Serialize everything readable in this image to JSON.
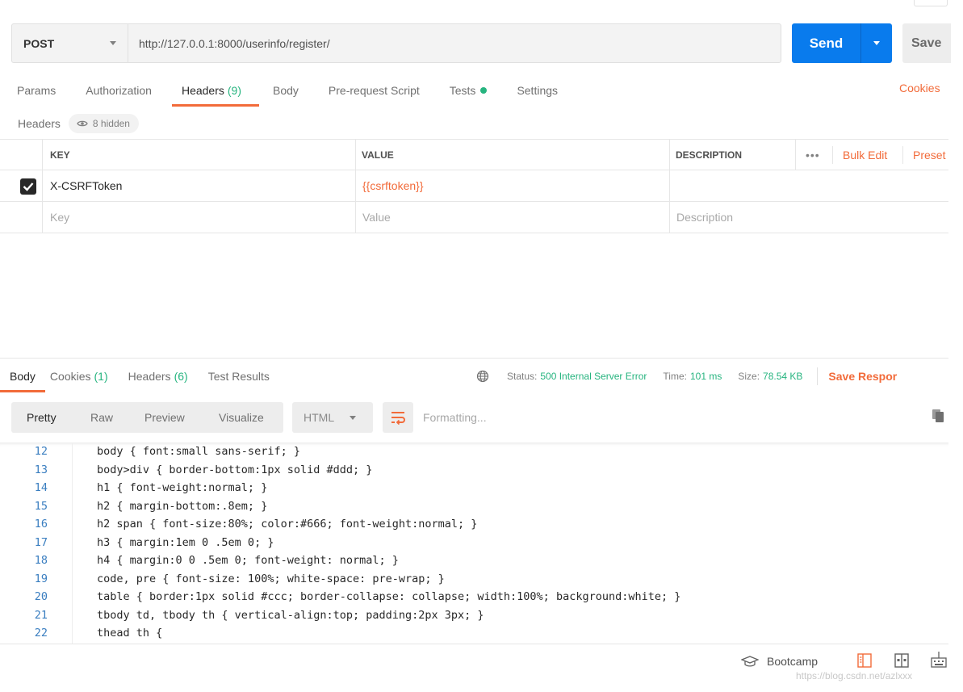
{
  "request": {
    "method": "POST",
    "url": "http://127.0.0.1:8000/userinfo/register/",
    "send_label": "Send",
    "save_label": "Save"
  },
  "request_tabs": {
    "params": "Params",
    "authorization": "Authorization",
    "headers": "Headers",
    "headers_count": "(9)",
    "body": "Body",
    "prerequest": "Pre-request Script",
    "tests": "Tests",
    "settings": "Settings",
    "cookies": "Cookies"
  },
  "headers_panel": {
    "label": "Headers",
    "hidden_label": "8 hidden",
    "columns": {
      "key": "KEY",
      "value": "VALUE",
      "description": "DESCRIPTION"
    },
    "more_label": "•••",
    "bulk_edit": "Bulk Edit",
    "presets": "Preset",
    "rows": [
      {
        "key": "X-CSRFToken",
        "value": "{{csrftoken}}",
        "description": "",
        "checked": true
      }
    ],
    "placeholders": {
      "key": "Key",
      "value": "Value",
      "description": "Description"
    }
  },
  "response": {
    "tabs": {
      "body": "Body",
      "cookies": "Cookies",
      "cookies_count": "(1)",
      "headers": "Headers",
      "headers_count": "(6)",
      "test_results": "Test Results"
    },
    "status_label": "Status:",
    "status_value": "500 Internal Server Error",
    "time_label": "Time:",
    "time_value": "101 ms",
    "size_label": "Size:",
    "size_value": "78.54 KB",
    "save_response": "Save Respor",
    "views": {
      "pretty": "Pretty",
      "raw": "Raw",
      "preview": "Preview",
      "visualize": "Visualize"
    },
    "format": "HTML",
    "formatting_placeholder": "Formatting...",
    "code_lines": [
      {
        "n": "12",
        "text": "body { font:small sans-serif; }"
      },
      {
        "n": "13",
        "text": "body>div { border-bottom:1px solid #ddd; }"
      },
      {
        "n": "14",
        "text": "h1 { font-weight:normal; }"
      },
      {
        "n": "15",
        "text": "h2 { margin-bottom:.8em; }"
      },
      {
        "n": "16",
        "text": "h2 span { font-size:80%; color:#666; font-weight:normal; }"
      },
      {
        "n": "17",
        "text": "h3 { margin:1em 0 .5em 0; }"
      },
      {
        "n": "18",
        "text": "h4 { margin:0 0 .5em 0; font-weight: normal; }"
      },
      {
        "n": "19",
        "text": "code, pre { font-size: 100%; white-space: pre-wrap; }"
      },
      {
        "n": "20",
        "text": "table { border:1px solid #ccc; border-collapse: collapse; width:100%; background:white; }"
      },
      {
        "n": "21",
        "text": "tbody td, tbody th { vertical-align:top; padding:2px 3px; }"
      },
      {
        "n": "22",
        "text": "thead th {"
      }
    ]
  },
  "footer": {
    "bootcamp": "Bootcamp",
    "watermark": "https://blog.csdn.net/azlxxx"
  },
  "colors": {
    "accent": "#f26b3a",
    "send_blue": "#097bed",
    "status_green": "#26b47f"
  },
  "icons": [
    "chevron-down-icon",
    "eye-icon",
    "check-icon",
    "globe-icon",
    "wrap-lines-icon",
    "copy-icon",
    "graduation-cap-icon",
    "sidebar-toggle-icon",
    "two-pane-icon",
    "keyboard-shortcuts-icon"
  ]
}
